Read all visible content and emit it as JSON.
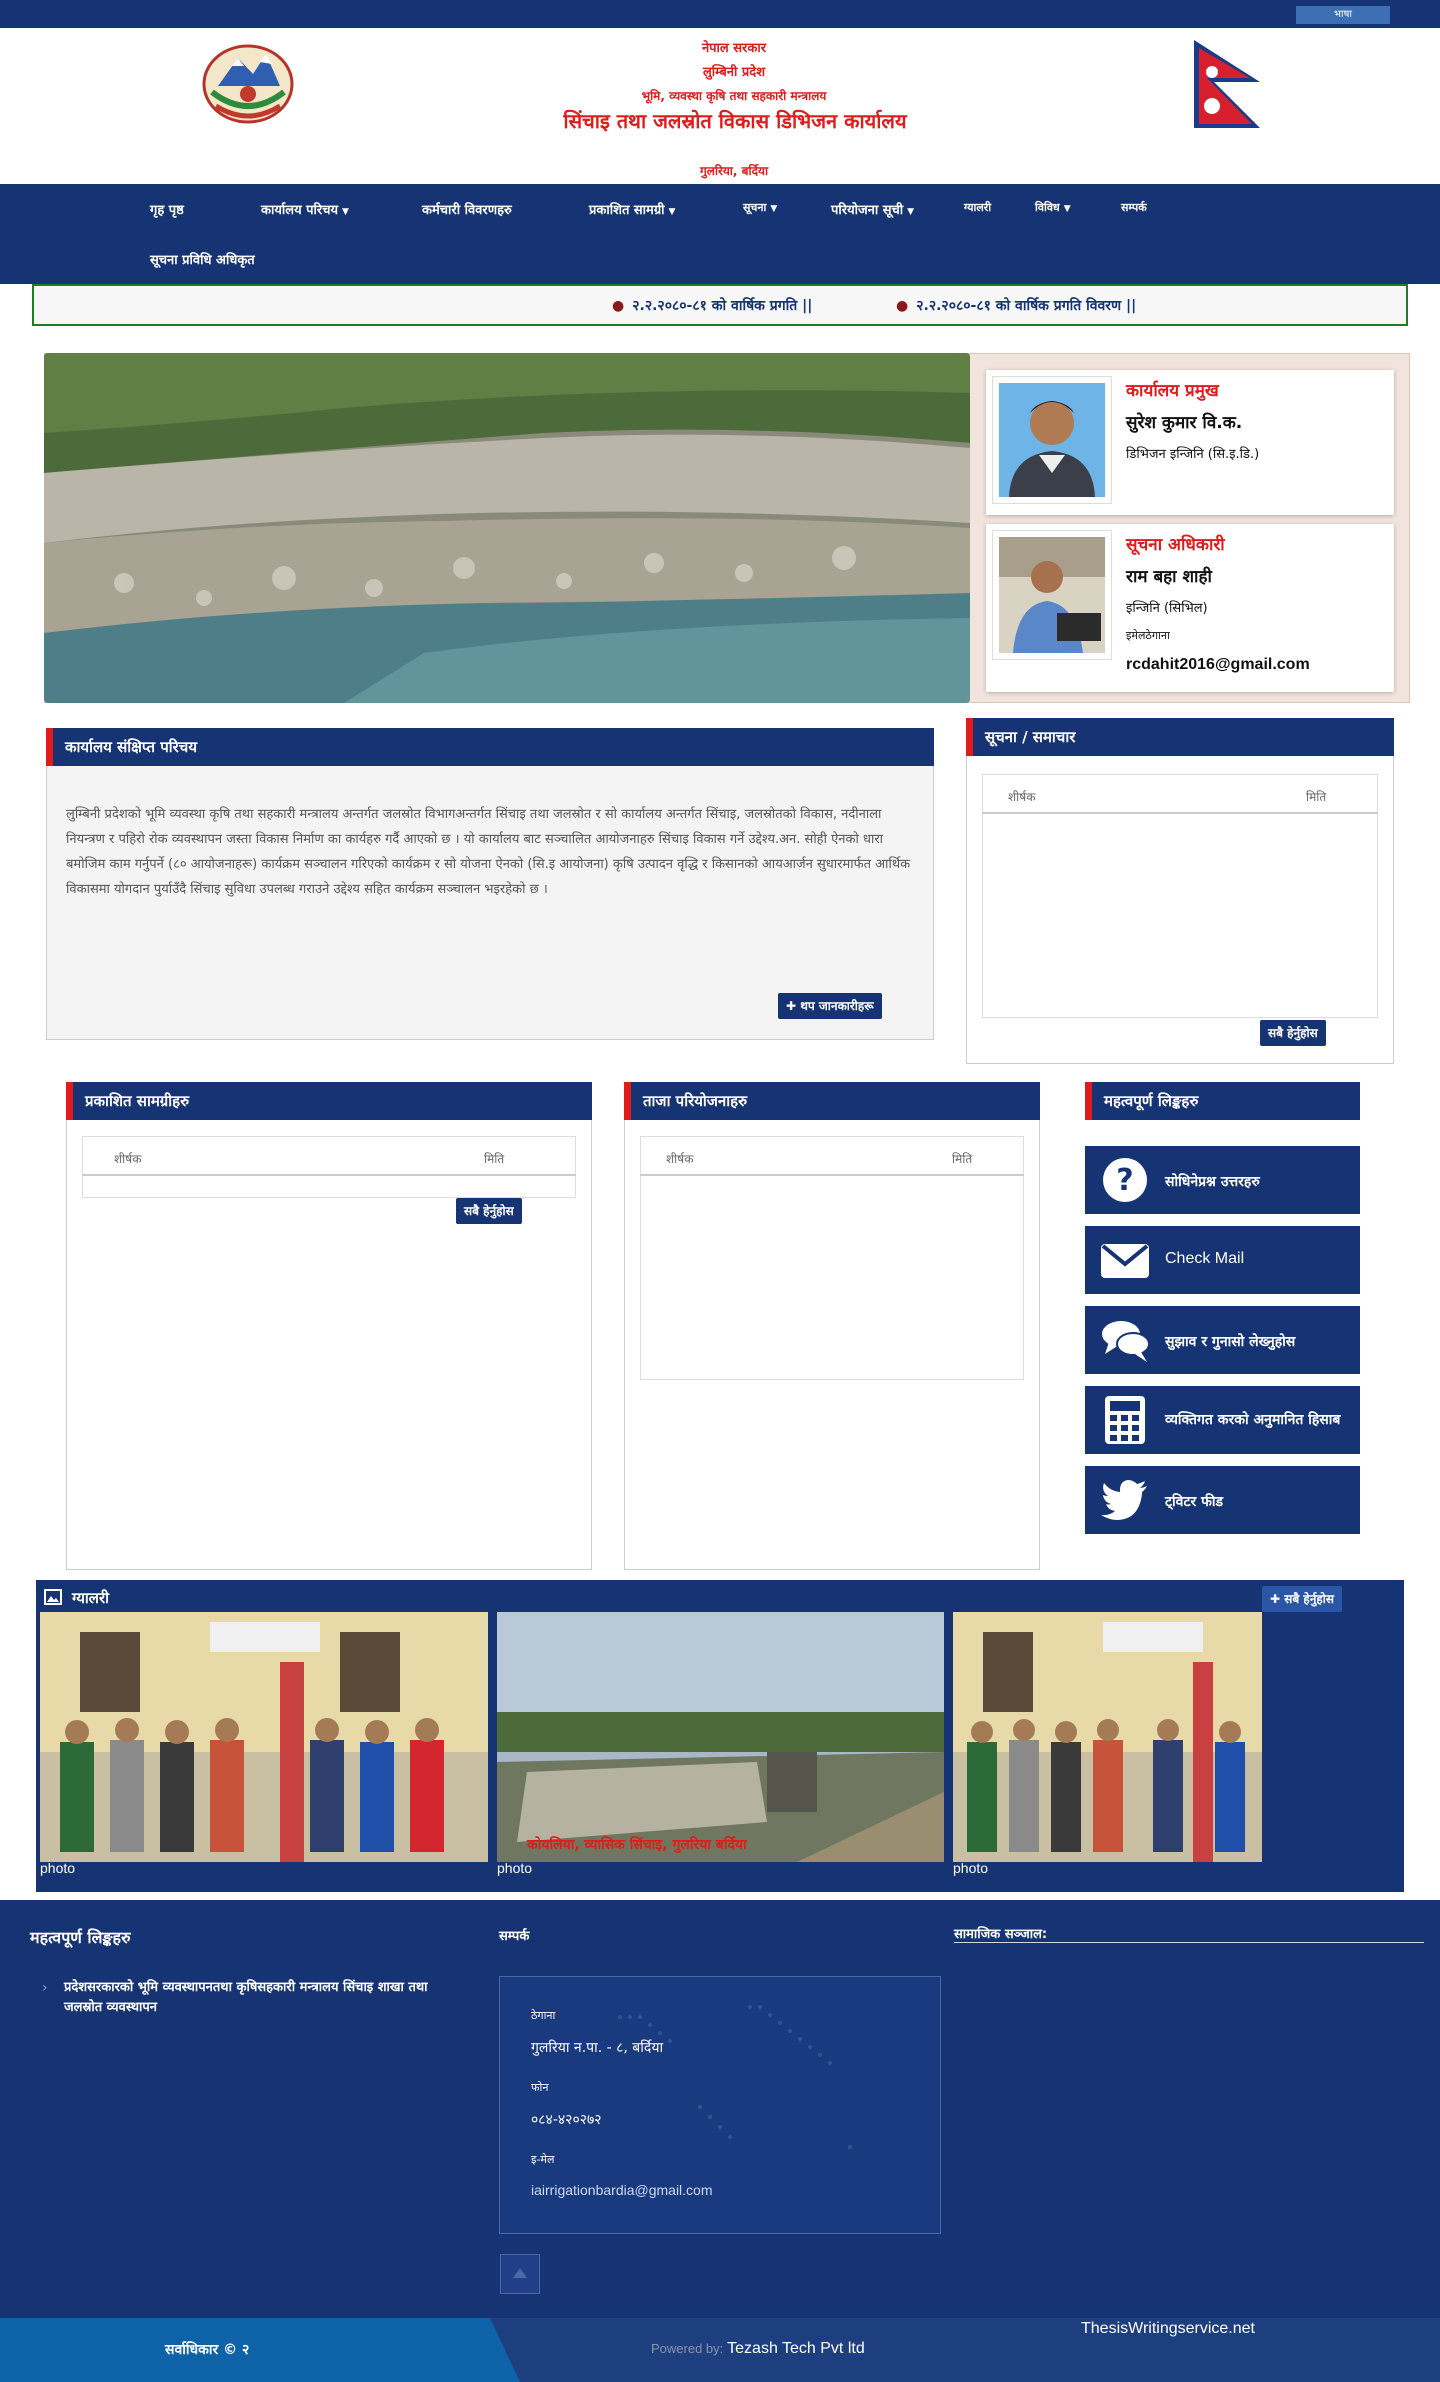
{
  "topbar": {
    "lang_button": "भाषा"
  },
  "header": {
    "line1": "नेपाल सरकार",
    "line2": "लुम्बिनी प्रदेश",
    "line3": "भूमि, व्यवस्था कृषि तथा सहकारी मन्त्रालय",
    "line4": "सिंचाइ तथा जलस्रोत विकास डिभिजन कार्यालय",
    "line5": "गुलरिया, बर्दिया"
  },
  "nav": {
    "items": [
      {
        "label": "गृह पृष्ठ",
        "dropdown": false
      },
      {
        "label": "कार्यालय परिचय",
        "dropdown": true
      },
      {
        "label": "कर्मचारी विवरणहरु",
        "dropdown": false
      },
      {
        "label": "प्रकाशित सामग्री",
        "dropdown": true
      },
      {
        "label": "सूचना",
        "dropdown": true
      },
      {
        "label": "परियोजना सूची",
        "dropdown": true
      },
      {
        "label": "ग्यालरी",
        "dropdown": false
      },
      {
        "label": "विविध",
        "dropdown": true
      },
      {
        "label": "सम्पर्क",
        "dropdown": false
      },
      {
        "label": "सूचना प्रविधि अधिकृत",
        "dropdown": false
      }
    ]
  },
  "ticker": {
    "items": [
      "२.२.२०८०-८१ को वार्षिक प्रगति ||",
      "२.२.२०८०-८१ को वार्षिक प्रगति विवरण ||"
    ]
  },
  "staff": [
    {
      "role": "कार्यालय प्रमुख",
      "name": "सुरेश कुमार वि.क.",
      "position": "डिभिजन इन्जिनि (सि.इ.डि.)",
      "extra_label": "",
      "email": ""
    },
    {
      "role": "सूचना अधिकारी",
      "name": "राम बहा शाही",
      "position": "इन्जिनि (सिभिल)",
      "extra_label": "इमेलठेगाना",
      "email": "rcdahit2016@gmail.com"
    }
  ],
  "intro": {
    "title": "कार्यालय संक्षिप्त परिचय",
    "body": "लुम्बिनी प्रदेशको भूमि व्यवस्था कृषि तथा सहकारी मन्त्रालय अन्तर्गत जलस्रोत विभागअन्तर्गत सिंचाइ तथा जलस्रोत र सो कार्यालय अन्तर्गत सिंचाइ, जलस्रोतको विकास, नदीनाला नियन्त्रण र पहिरो रोक व्यवस्थापन जस्ता विकास निर्माण का कार्यहरु गर्दै आएको छ । यो कार्यालय बाट सञ्चालित आयोजनाहरु सिंचाइ विकास गर्ने उद्देश्य.अन. सोही ऐनको धारा बमोजिम काम गर्नुपर्ने (८० आयोजनाहरू) कार्यक्रम सञ्चालन गरिएको कार्यक्रम र सो योजना ऐनको (सि.इ आयोजना) कृषि उत्पादन वृद्धि र किसानको आयआर्जन सुधारमार्फत आर्थिक विकासमा योगदान पुर्याउँदै सिंचाइ सुविधा उपलब्ध गराउने उद्देश्य सहित कार्यक्रम सञ्चालन भइरहेको छ ।",
    "button": "थप जानकारीहरू"
  },
  "notice": {
    "title": "सूचना / समाचार",
    "col1": "शीर्षक",
    "col2": "मिति",
    "button": "सबै हेर्नुहोस"
  },
  "published": {
    "title": "प्रकाशित सामग्रीहरु",
    "col1": "शीर्षक",
    "col2": "मिति",
    "button": "सबै हेर्नुहोस"
  },
  "projects": {
    "title": "ताजा परियोजनाहरु",
    "col1": "शीर्षक",
    "col2": "मिति"
  },
  "links": {
    "title": "महत्वपूर्ण लिङ्कहरु",
    "items": [
      {
        "label": "सोधिनेप्रश्न उत्तरहरु",
        "icon": "question-icon"
      },
      {
        "label": "Check Mail",
        "icon": "mail-icon"
      },
      {
        "label": "सुझाव र गुनासो लेख्नुहोस",
        "icon": "comments-icon"
      },
      {
        "label": "व्यक्तिगत करको अनुमानित हिसाब",
        "icon": "calculator-icon"
      },
      {
        "label": "ट्विटर फीड",
        "icon": "twitter-icon"
      }
    ]
  },
  "gallery": {
    "title": "ग्यालरी",
    "button": "सबै हेर्नुहोस",
    "captions": [
      "photo",
      "photo",
      "photo"
    ],
    "overlay_text": "कोयलिया, व्यासिक सिंचाइ, गुलरिया बर्दिया"
  },
  "footer": {
    "col1_title": "महत्वपूर्ण लिङ्कहरु",
    "col1_link": "प्रदेशसरकारको भूमि व्यवस्थापनतथा कृषिसहकारी मन्त्रालय सिंचाइ शाखा तथा जलस्रोत व्यवस्थापन",
    "col2_title": "सम्पर्क",
    "address_label": "ठेगाना",
    "address_value": "गुलरिया न.पा. - ८, बर्दिया",
    "phone_label": "फोन",
    "phone_value": "०८४-४२०२७२",
    "email_label": "इ-मेल",
    "email_value": "iairrigationbardia@gmail.com",
    "col3_title": "सामाजिक सञ्जाल:"
  },
  "bottom": {
    "copyright": "सर्वाधिकार © २",
    "powered_label": "Powered by:",
    "powered_by": "Tezash Tech Pvt ltd",
    "thesis": "ThesisWritingservice.net"
  },
  "colors": {
    "navy": "#163373",
    "red": "#e01b1b",
    "ticker_border": "#1e7d1e"
  }
}
